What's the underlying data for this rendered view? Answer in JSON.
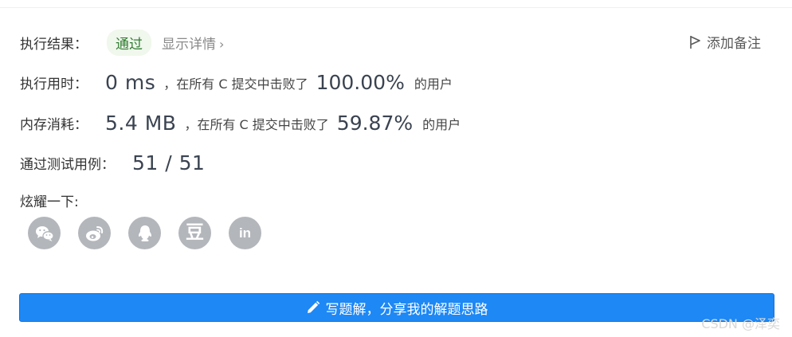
{
  "result": {
    "label": "执行结果：",
    "status": "通过",
    "detail": "显示详情",
    "detail_chevron": "›"
  },
  "add_note": {
    "label": "添加备注",
    "icon": "flag-icon"
  },
  "runtime": {
    "label": "执行用时：",
    "value": "0 ms",
    "text_before": "，在所有 C 提交中击败了",
    "percent": "100.00%",
    "text_after": "的用户"
  },
  "memory": {
    "label": "内存消耗：",
    "value": "5.4 MB",
    "text_before": "，在所有 C 提交中击败了",
    "percent": "59.87%",
    "text_after": "的用户"
  },
  "tests": {
    "label": "通过测试用例：",
    "value": "51 / 51"
  },
  "share": {
    "label": "炫耀一下:",
    "icons": [
      "wechat-icon",
      "weibo-icon",
      "qq-icon",
      "douban-icon",
      "linkedin-icon"
    ],
    "douban_glyph": "豆",
    "linkedin_glyph": "in"
  },
  "write_solution": {
    "label": "写题解，分享我的解题思路",
    "icon": "pencil-icon"
  },
  "watermark": "CSDN @泽奕",
  "colors": {
    "accent": "#1e88f5",
    "pass_bg": "#f0f7ec",
    "pass_text": "#2f7d32",
    "icon_gray": "#b3b6bb"
  }
}
